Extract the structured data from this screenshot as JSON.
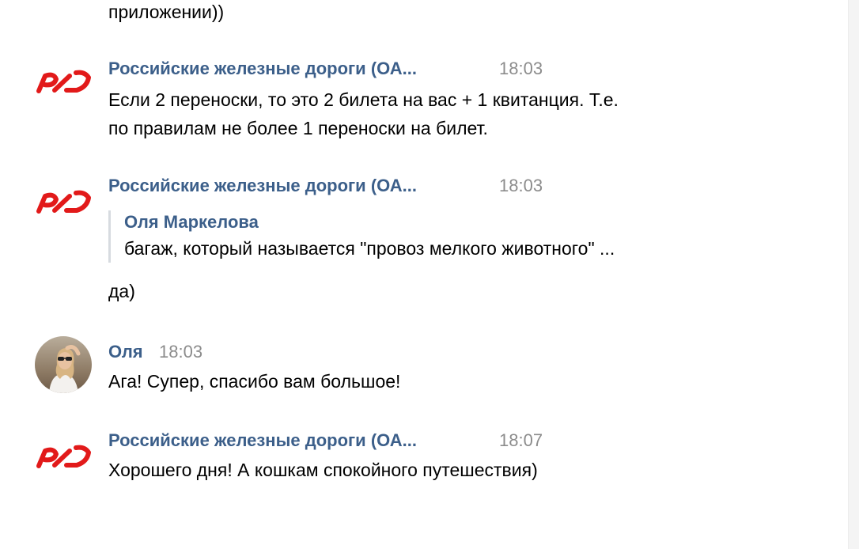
{
  "top_fragment": "приложении))",
  "messages": [
    {
      "sender": "Российские железные дороги (ОА...",
      "time": "18:03",
      "lines": [
        "Если 2 переноски, то это 2 билета на вас + 1 квитанция. Т.е.",
        "по правилам не более 1 переноски на билет."
      ]
    },
    {
      "sender": "Российские железные дороги (ОА...",
      "time": "18:03",
      "quote": {
        "author": "Оля Маркелова",
        "text": "багаж, который называется \"провоз мелкого животного\" ..."
      },
      "lines": [
        "да)"
      ]
    },
    {
      "sender": "Оля",
      "time": "18:03",
      "lines": [
        "Ага! Супер, спасибо вам большое!"
      ]
    },
    {
      "sender": "Российские железные дороги (ОА...",
      "time": "18:07",
      "lines": [
        "Хорошего дня! А кошкам спокойного путешествия)"
      ]
    }
  ],
  "colors": {
    "sender_name": "#3c5f8a",
    "timestamp": "#8c8c8c",
    "rzd_logo": "#e21a1a",
    "quote_bar": "#d7dbe0"
  },
  "icons": {
    "company_avatar": "rzd-logo-icon",
    "user_avatar": "user-avatar-photo"
  }
}
